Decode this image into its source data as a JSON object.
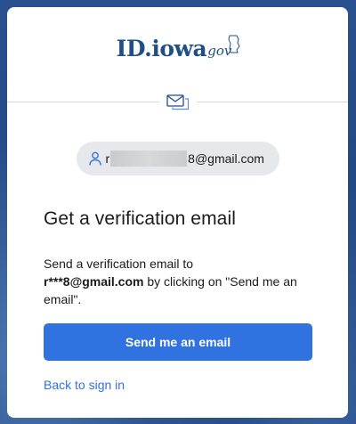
{
  "logo": {
    "main": "ID.iowa",
    "suffix": "gov"
  },
  "user": {
    "email_prefix": "r",
    "email_suffix": "8@gmail.com"
  },
  "content": {
    "heading": "Get a verification email",
    "desc_intro": "Send a verification email to",
    "desc_email": "r***8@gmail.com",
    "desc_rest": "by clicking on \"Send me an email\"."
  },
  "actions": {
    "send_label": "Send me an email",
    "back_label": "Back to sign in"
  },
  "colors": {
    "primary": "#2f72e0",
    "logo": "#1f4f86",
    "background": "#1d3f7a"
  }
}
